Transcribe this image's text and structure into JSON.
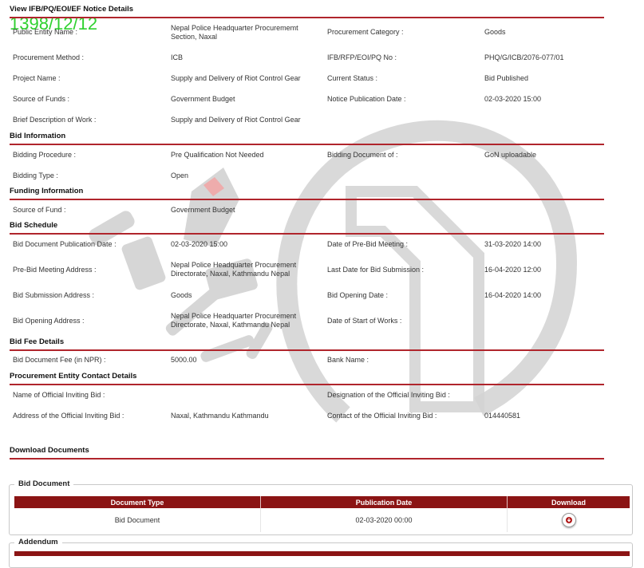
{
  "stamp": "1398/12/12",
  "sections": {
    "notice": "View IFB/PQ/EOI/EF Notice Details",
    "bid_info": "Bid Information",
    "funding": "Funding Information",
    "schedule": "Bid Schedule",
    "fee": "Bid Fee Details",
    "contact": "Procurement Entity Contact Details",
    "download": "Download Documents"
  },
  "notice": {
    "public_entity_label": "Public Entity Name :",
    "public_entity_value": "Nepal Police Headquarter Procurememt Section, Naxal",
    "category_label": "Procurement Category :",
    "category_value": "Goods",
    "method_label": "Procurement Method :",
    "method_value": "ICB",
    "ifb_label": "IFB/RFP/EOI/PQ No :",
    "ifb_value": "PHQ/G/ICB/2076-077/01",
    "project_label": "Project Name :",
    "project_value": "Supply and Delivery of Riot Control Gear",
    "status_label": "Current Status :",
    "status_value": "Bid Published",
    "funds_label": "Source of Funds :",
    "funds_value": "Government Budget",
    "pubdate_label": "Notice Publication Date :",
    "pubdate_value": "02-03-2020 15:00",
    "brief_label": "Brief Description of Work :",
    "brief_value": "Supply and Delivery of Riot Control Gear"
  },
  "bid_info": {
    "procedure_label": "Bidding Procedure :",
    "procedure_value": "Pre Qualification Not Needed",
    "document_of_label": "Bidding Document of :",
    "document_of_value": "GoN uploadable",
    "type_label": "Bidding Type :",
    "type_value": "Open"
  },
  "funding": {
    "source_label": "Source of Fund :",
    "source_value": "Government Budget"
  },
  "schedule": {
    "doc_pub_label": "Bid Document Publication Date :",
    "doc_pub_value": "02-03-2020 15:00",
    "prebid_date_label": "Date of Pre-Bid Meeting :",
    "prebid_date_value": "31-03-2020 14:00",
    "prebid_addr_label": "Pre-Bid Meeting Address :",
    "prebid_addr_value": "Nepal Police Headquarter Procurement Directorate, Naxal, Kathmandu Nepal",
    "last_date_label": "Last Date for Bid Submission :",
    "last_date_value": "16-04-2020 12:00",
    "submission_addr_label": "Bid Submission Address :",
    "submission_addr_value": "Goods",
    "opening_date_label": "Bid Opening Date :",
    "opening_date_value": "16-04-2020 14:00",
    "opening_addr_label": "Bid Opening Address :",
    "opening_addr_value": "Nepal Police Headquarter Procurement Directorate, Naxal, Kathmandu Nepal",
    "start_works_label": "Date of Start of Works :",
    "start_works_value": ""
  },
  "fee": {
    "fee_label": "Bid Document Fee (in NPR) :",
    "fee_value": "5000.00",
    "bank_label": "Bank Name :",
    "bank_value": ""
  },
  "contact": {
    "official_name_label": "Name of Official Inviting Bid :",
    "official_name_value": "",
    "designation_label": "Designation of the Official Inviting Bid :",
    "designation_value": "",
    "address_label": "Address of the Official Inviting Bid :",
    "address_value": "Naxal, Kathmandu Kathmandu",
    "contact_label": "Contact of the Official Inviting Bid :",
    "contact_value": "014440581"
  },
  "bid_document": {
    "legend": "Bid Document",
    "headers": [
      "Document Type",
      "Publication Date",
      "Download"
    ],
    "rows": [
      {
        "type": "Bid Document",
        "date": "02-03-2020 00:00",
        "download_icon": "download-icon"
      }
    ]
  },
  "addendum": {
    "legend": "Addendum"
  },
  "colors": {
    "accent_red": "#b0252c",
    "header_bg": "#8b1414",
    "stamp_green": "#2fd12f",
    "watermark_gray": "#c4c4c4",
    "watermark_red": "#f0a0a0"
  }
}
